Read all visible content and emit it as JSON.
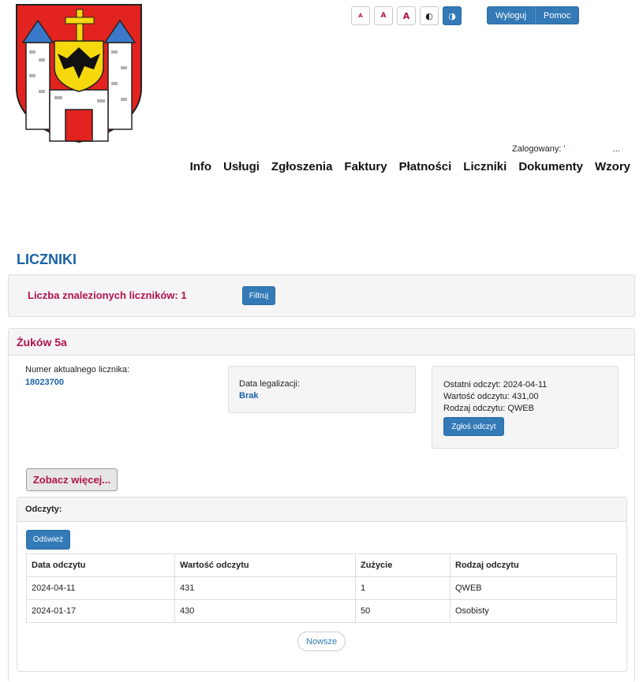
{
  "header": {
    "logo": {
      "icon": "coat-of-arms-icon",
      "colors": {
        "field": "#e3231f",
        "tower": "#ffffff",
        "cross": "#f5d90c",
        "eagle_shield": "#f5d90c",
        "roof": "#3a79c9"
      }
    },
    "font_size_buttons": [
      "A",
      "A",
      "A"
    ],
    "contrast_buttons": [
      "contrast-icon",
      "contrast-icon"
    ],
    "logout_label": "Wyloguj",
    "help_label": "Pomoc",
    "logged_in_label": "Zalogowany:",
    "logged_in_user": "'",
    "logged_in_user_suffix": "..."
  },
  "nav": [
    "Info",
    "Usługi",
    "Zgłoszenia",
    "Faktury",
    "Płatności",
    "Liczniki",
    "Dokumenty",
    "Wzory"
  ],
  "page": {
    "title": "LICZNIKI",
    "count_label": "Liczba znalezionych liczników: 1",
    "filter_label": "Filtruj"
  },
  "meter_panel": {
    "address": "Żuków 5a",
    "meter_number_label": "Numer aktualnego licznika:",
    "meter_number": "18023700",
    "legalization_label": "Data legalizacji:",
    "legalization_value": "Brak",
    "last_reading": "Ostatni odczyt: 2024-04-11",
    "reading_value": "Wartość odczytu: 431,00",
    "reading_type": "Rodzaj odczytu: QWEB",
    "report_button": "Zgłoś odczyt",
    "more_button": "Zobacz więcej..."
  },
  "readings": {
    "title": "Odczyty:",
    "refresh_button": "Odśwież",
    "columns": [
      "Data odczytu",
      "Wartość odczytu",
      "Zużycie",
      "Rodzaj odczytu"
    ],
    "rows": [
      [
        "2024-04-11",
        "431",
        "1",
        "QWEB"
      ],
      [
        "2024-01-17",
        "430",
        "50",
        "Osobisty"
      ]
    ],
    "newer_button": "Nowsze"
  },
  "colors": {
    "accent": "#337ab7",
    "brand": "#b0124f",
    "title": "#1a62a8",
    "panel_bg": "#f5f5f5",
    "border": "#dddddd"
  }
}
